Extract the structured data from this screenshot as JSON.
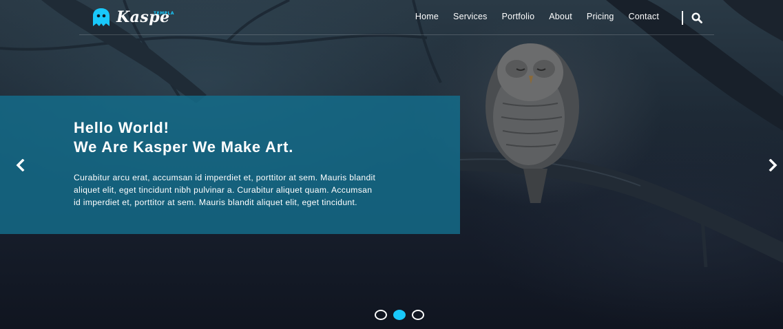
{
  "brand": {
    "logo_text": "Kaspe",
    "logo_small_text": "TEMPLA",
    "logo_icon": "ghost-icon",
    "accent_color": "#19c8fa"
  },
  "nav": {
    "items": [
      {
        "label": "Home"
      },
      {
        "label": "Services"
      },
      {
        "label": "Portfolio"
      },
      {
        "label": "About"
      },
      {
        "label": "Pricing"
      },
      {
        "label": "Contact"
      }
    ],
    "search_icon": "search-icon"
  },
  "slider": {
    "headline_line1": "Hello World!",
    "headline_line2": "We Are Kasper We Make Art.",
    "paragraph_line1": "Curabitur arcu erat, accumsan id imperdiet et, porttitor at sem. Mauris blandit",
    "paragraph_line2": "aliquet elit, eget tincidunt nibh pulvinar a. Curabitur aliquet quam. Accumsan",
    "paragraph_line3": "id imperdiet et, porttitor at sem. Mauris blandit aliquet elit, eget tincidunt.",
    "prev_icon": "chevron-left-icon",
    "next_icon": "chevron-right-icon",
    "bullets": [
      {
        "active": false
      },
      {
        "active": true
      },
      {
        "active": false
      }
    ],
    "box_color": "#146e8c"
  }
}
